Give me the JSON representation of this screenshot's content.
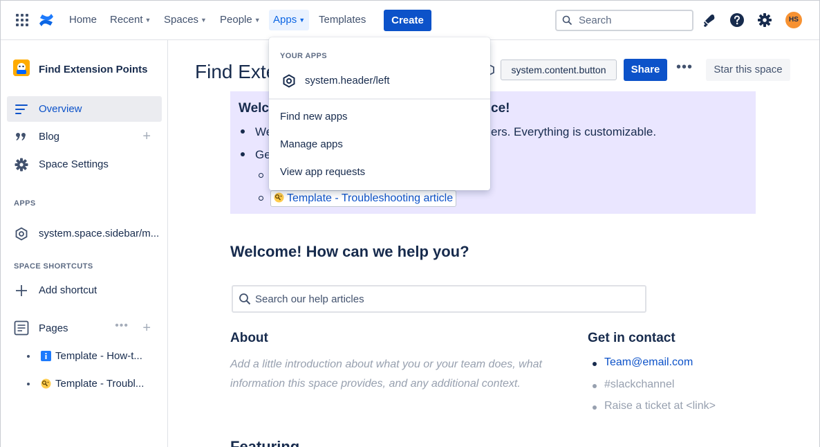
{
  "topnav": {
    "items": [
      {
        "label": "Home",
        "chevron": false
      },
      {
        "label": "Recent",
        "chevron": true
      },
      {
        "label": "Spaces",
        "chevron": true
      },
      {
        "label": "People",
        "chevron": true
      },
      {
        "label": "Apps",
        "chevron": true,
        "active": true
      },
      {
        "label": "Templates",
        "chevron": false
      }
    ],
    "create_label": "Create",
    "search_placeholder": "Search",
    "avatar_initials": "HS",
    "icons": [
      "app-switcher-icon",
      "confluence-logo-icon",
      "notifications-icon",
      "help-icon",
      "settings-icon"
    ]
  },
  "sidebar": {
    "space_title": "Find Extension Points",
    "items": [
      {
        "label": "Overview",
        "icon": "overview-icon",
        "selected": true
      },
      {
        "label": "Blog",
        "icon": "quote-icon"
      },
      {
        "label": "Space Settings",
        "icon": "gear-icon"
      }
    ],
    "apps_heading": "APPS",
    "app_item": "system.space.sidebar/m...",
    "shortcuts_heading": "SPACE SHORTCUTS",
    "add_shortcut": "Add shortcut",
    "pages_label": "Pages",
    "pages": [
      {
        "label": "Template - How-t...",
        "icon": "info-icon"
      },
      {
        "label": "Template - Troubl...",
        "icon": "detective-emoji-icon"
      }
    ]
  },
  "main": {
    "title": "Find Exte",
    "ext_button": "system.content.button",
    "share_label": "Share",
    "star_label": "Star this space",
    "panel": {
      "title_start": "Welco",
      "title_end": "ce!",
      "line1_start": "We",
      "line1_end": "ers. Everything is customizable.",
      "line2_start": "Ge",
      "template_link": "Template - Troubleshooting article"
    },
    "welcome_heading": "Welcome! How can we help you?",
    "help_search_placeholder": "Search our help articles",
    "about_heading": "About",
    "about_text": "Add a little introduction about what you or your team does, what information this space provides, and any additional context.",
    "contact_heading": "Get in contact",
    "contacts": [
      {
        "text": "Team@email.com",
        "color": "#0c52c9"
      },
      {
        "text": "#slackchannel",
        "color": "#97a0af"
      },
      {
        "text": "Raise a ticket at <link>",
        "color": "#97a0af"
      }
    ],
    "featuring_heading": "Featuring"
  },
  "dropdown": {
    "heading": "YOUR APPS",
    "app_label": "system.header/left",
    "items": [
      "Find new apps",
      "Manage apps",
      "View app requests"
    ]
  },
  "colors": {
    "accent": "#0c52c9",
    "panel_bg": "#eae6ff",
    "active_nav_bg": "#e9f2ff"
  }
}
